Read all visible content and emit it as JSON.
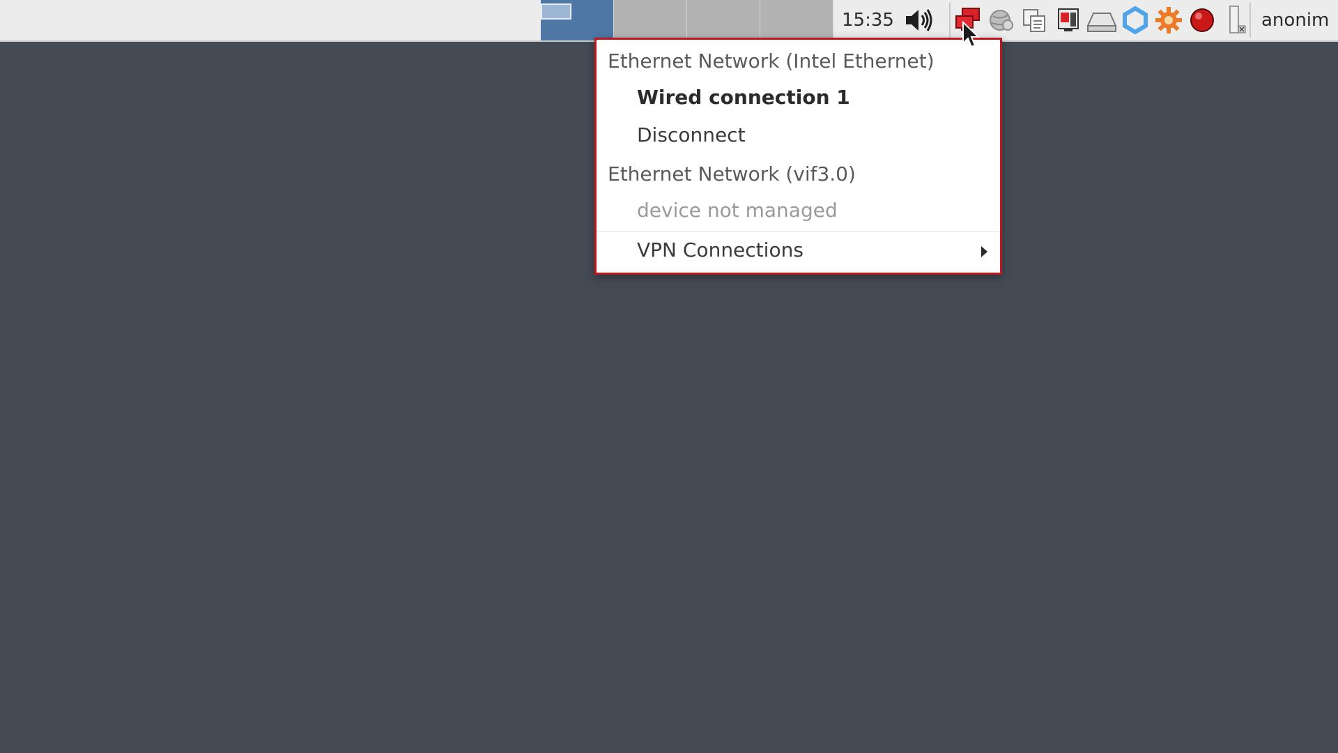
{
  "panel": {
    "clock": "15:35",
    "user": "anonim",
    "workspaces": [
      {
        "label": "",
        "active": true
      },
      {
        "label": "",
        "active": false
      },
      {
        "label": "",
        "active": false
      },
      {
        "label": "",
        "active": false
      }
    ],
    "tray_icons": [
      "volume-icon",
      "network-icon",
      "globe-icon",
      "clipboard-icon",
      "screen-record-icon",
      "drive-icon",
      "qubes-icon",
      "settings-gear-icon",
      "red-record-icon",
      "battery-icon"
    ]
  },
  "network_menu": {
    "section1_header": "Ethernet Network (Intel Ethernet)",
    "section1_connection": "Wired connection 1",
    "section1_action": "Disconnect",
    "section2_header": "Ethernet Network (vif3.0)",
    "section2_status": "device not managed",
    "vpn_label": "VPN Connections"
  },
  "colors": {
    "desktop": "#434b54",
    "menu_border": "#c0161d",
    "active_workspace": "#4f77a6"
  }
}
